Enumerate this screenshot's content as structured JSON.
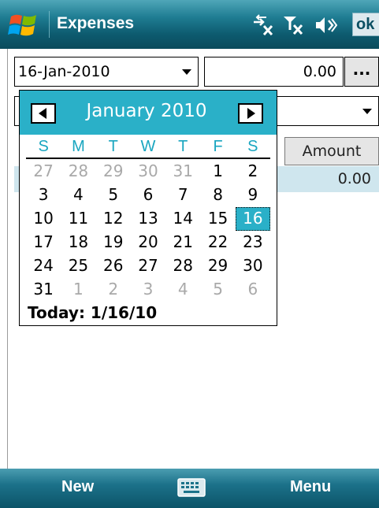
{
  "titlebar": {
    "app_title": "Expenses",
    "ok_label": "ok",
    "icons": [
      "windows-start-logo",
      "connectivity-off-icon",
      "signal-off-icon",
      "speaker-icon"
    ]
  },
  "form": {
    "date_value": "16-Jan-2010",
    "amount_value": "0.00",
    "ellipsis_label": "...",
    "category_value": ""
  },
  "grid": {
    "columns": [
      "Amount"
    ],
    "rows": [
      {
        "amount": "0.00"
      }
    ]
  },
  "calendar": {
    "month_label": "January 2010",
    "weekdays": [
      "S",
      "M",
      "T",
      "W",
      "T",
      "F",
      "S"
    ],
    "weeks": [
      [
        {
          "d": "27",
          "o": true
        },
        {
          "d": "28",
          "o": true
        },
        {
          "d": "29",
          "o": true
        },
        {
          "d": "30",
          "o": true
        },
        {
          "d": "31",
          "o": true
        },
        {
          "d": "1"
        },
        {
          "d": "2"
        }
      ],
      [
        {
          "d": "3"
        },
        {
          "d": "4"
        },
        {
          "d": "5"
        },
        {
          "d": "6"
        },
        {
          "d": "7"
        },
        {
          "d": "8"
        },
        {
          "d": "9"
        }
      ],
      [
        {
          "d": "10"
        },
        {
          "d": "11"
        },
        {
          "d": "12"
        },
        {
          "d": "13"
        },
        {
          "d": "14"
        },
        {
          "d": "15"
        },
        {
          "d": "16",
          "sel": true
        }
      ],
      [
        {
          "d": "17"
        },
        {
          "d": "18"
        },
        {
          "d": "19"
        },
        {
          "d": "20"
        },
        {
          "d": "21"
        },
        {
          "d": "22"
        },
        {
          "d": "23"
        }
      ],
      [
        {
          "d": "24"
        },
        {
          "d": "25"
        },
        {
          "d": "26"
        },
        {
          "d": "27"
        },
        {
          "d": "28"
        },
        {
          "d": "29"
        },
        {
          "d": "30"
        }
      ],
      [
        {
          "d": "31"
        },
        {
          "d": "1",
          "o": true
        },
        {
          "d": "2",
          "o": true
        },
        {
          "d": "3",
          "o": true
        },
        {
          "d": "4",
          "o": true
        },
        {
          "d": "5",
          "o": true
        },
        {
          "d": "6",
          "o": true
        }
      ]
    ],
    "today_label": "Today: 1/16/10"
  },
  "softkeys": {
    "left_label": "New",
    "right_label": "Menu"
  },
  "colors": {
    "accent": "#2ab0c8",
    "titlebar": "#1f7d93",
    "selected_row": "#cfe6ee"
  }
}
